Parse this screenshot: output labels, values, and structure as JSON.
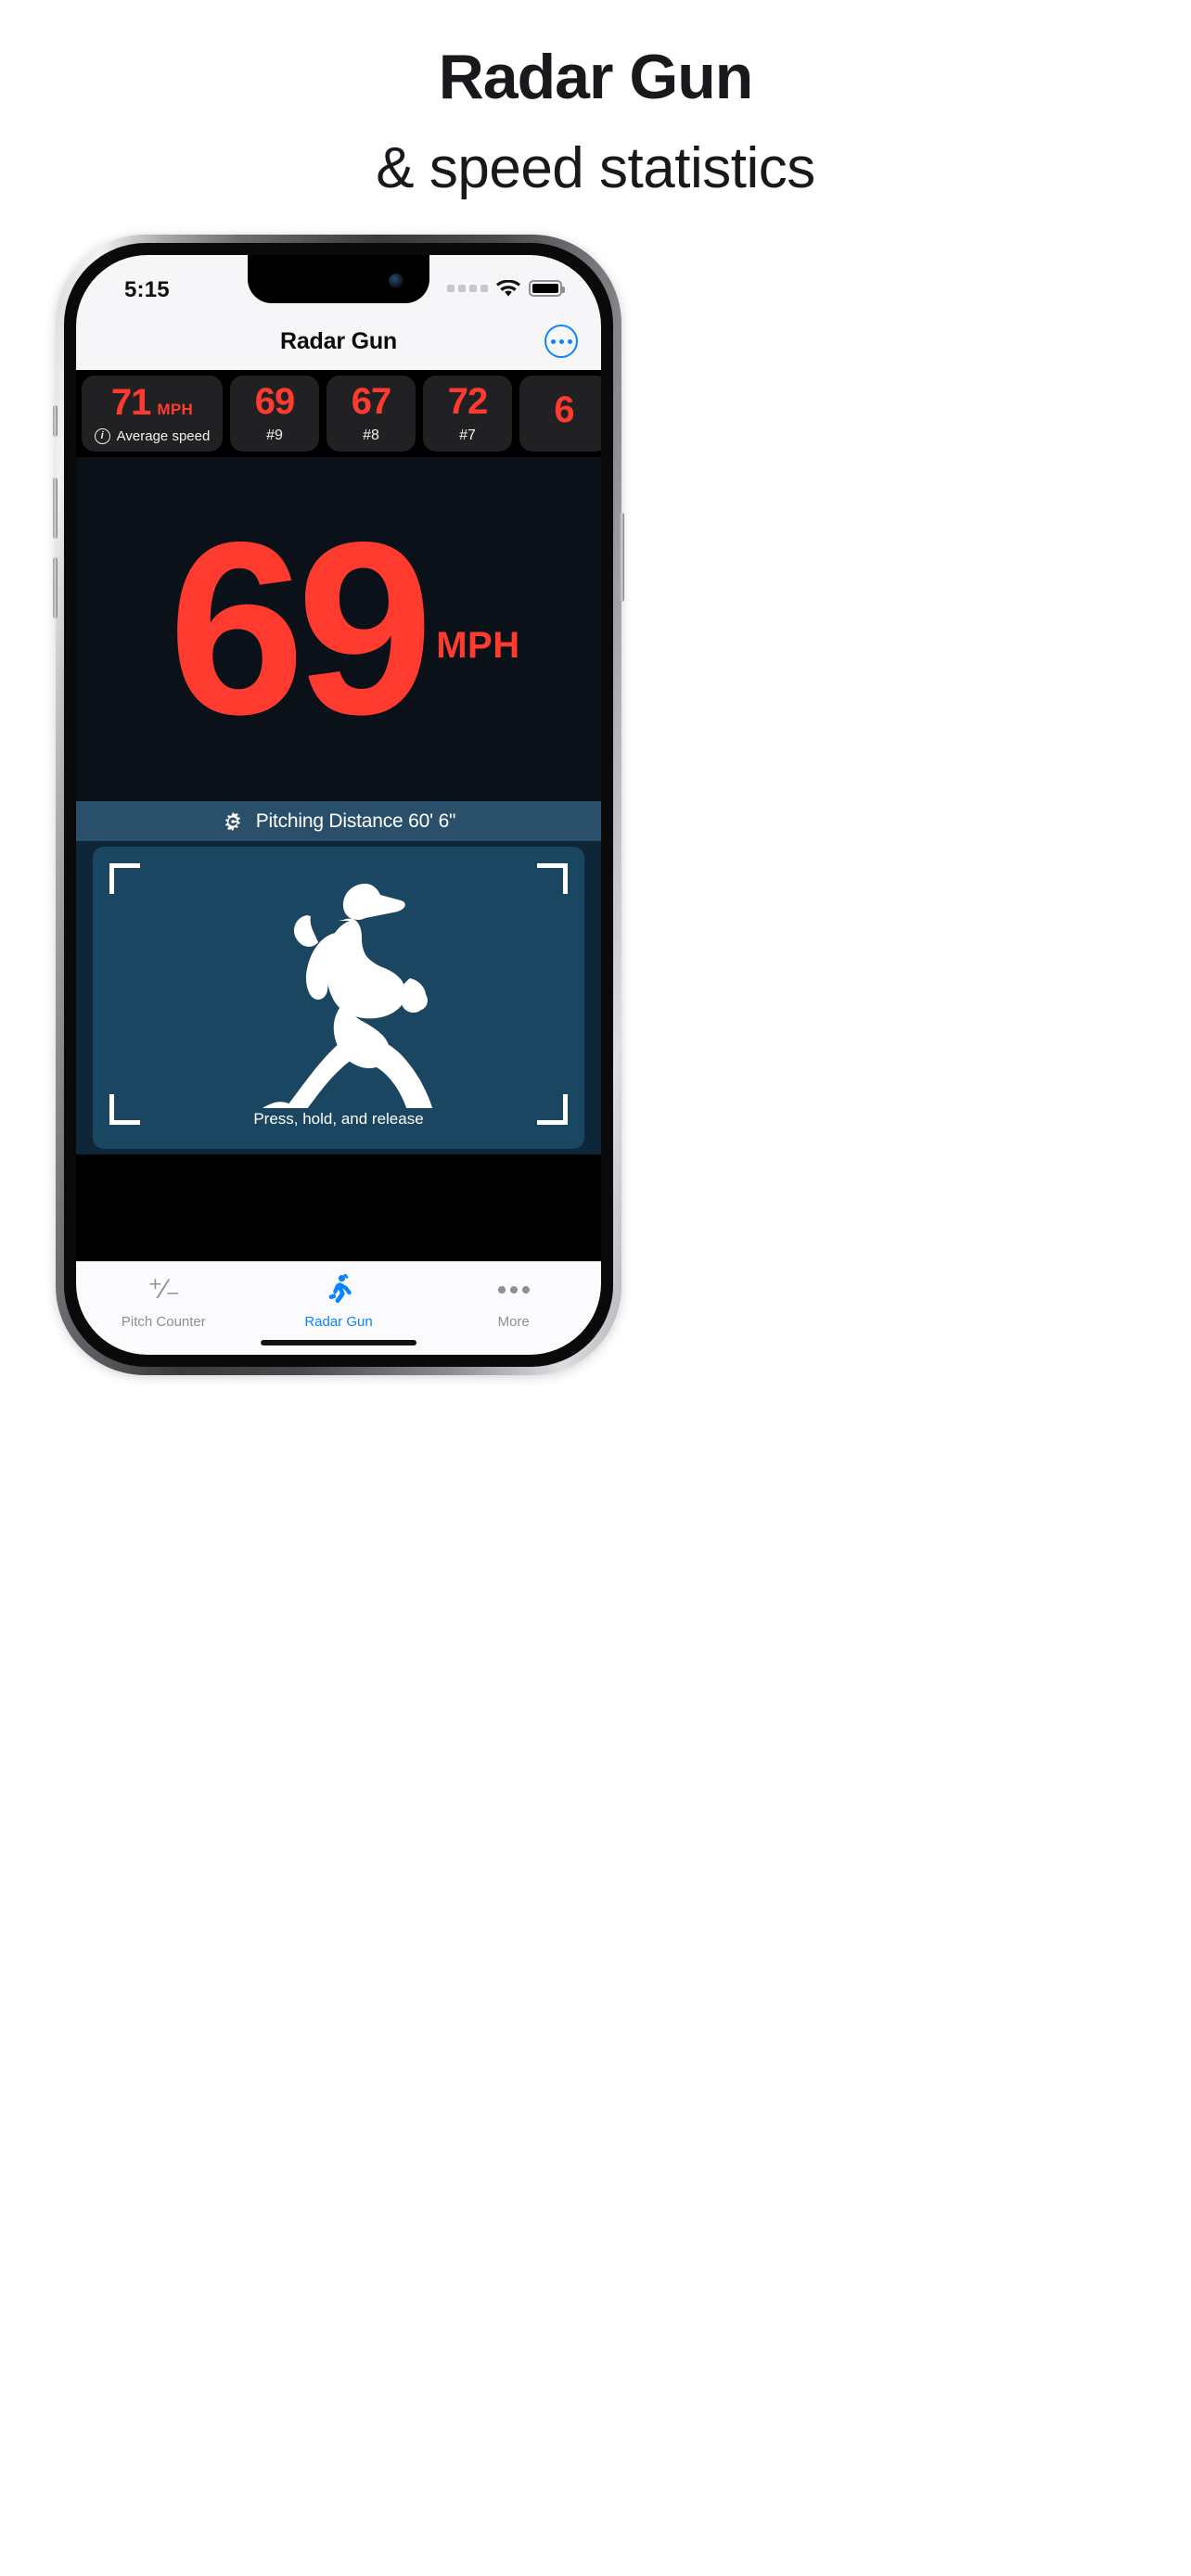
{
  "promo": {
    "title": "Radar Gun",
    "subtitle": "& speed statistics"
  },
  "phone": {
    "status_bar": {
      "time": "5:15",
      "signal_icon": "signal-dots-icon",
      "wifi_icon": "wifi-icon",
      "battery_icon": "battery-full-icon"
    },
    "nav_bar": {
      "title": "Radar Gun",
      "more_button": "more-ellipsis-circle-icon"
    },
    "speed_cards": [
      {
        "value": "71",
        "unit": "MPH",
        "label": "Average speed",
        "info_icon": "info-circle-icon",
        "type": "average"
      },
      {
        "value": "69",
        "rank": "#9",
        "type": "reading"
      },
      {
        "value": "67",
        "rank": "#8",
        "type": "reading"
      },
      {
        "value": "72",
        "rank": "#7",
        "type": "reading"
      },
      {
        "value": "6",
        "rank": "",
        "type": "reading-partial"
      }
    ],
    "reading": {
      "value": "69",
      "unit": "MPH"
    },
    "distance_bar": {
      "icon": "gear-icon",
      "label": "Pitching Distance 60' 6\""
    },
    "capture_panel": {
      "hint": "Press, hold, and release",
      "subject_icon": "pitcher-silhouette-icon"
    },
    "tabs": [
      {
        "label": "Pitch Counter",
        "icon": "plus-minus-icon",
        "active": false
      },
      {
        "label": "Radar Gun",
        "icon": "running-person-icon",
        "active": true
      },
      {
        "label": "More",
        "icon": "ellipsis-icon",
        "active": false
      }
    ]
  },
  "colors": {
    "accent_red": "#ff3b30",
    "accent_blue": "#0a84ff",
    "panel_dark": "#0b1118",
    "panel_blue": "#1b4662",
    "bar_blue": "#2a4f6b"
  }
}
